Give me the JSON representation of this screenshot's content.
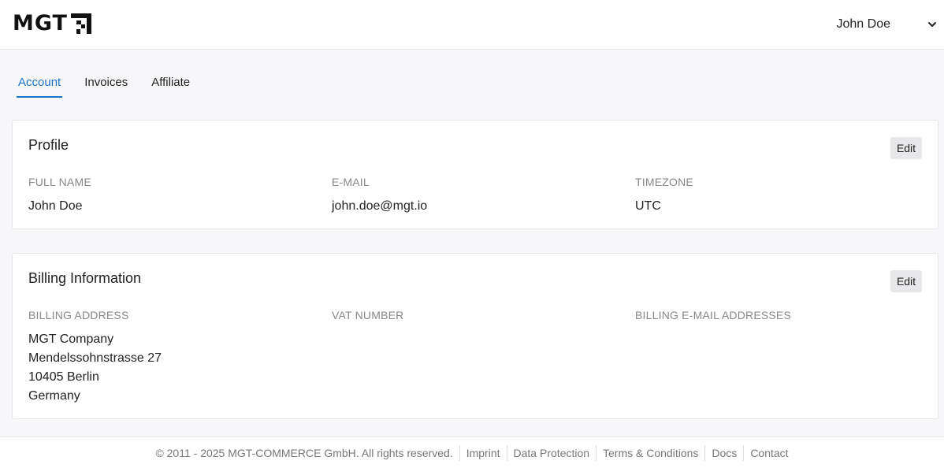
{
  "header": {
    "logo_text": "MGT",
    "user_name": "John Doe"
  },
  "tabs": [
    {
      "label": "Account",
      "active": true
    },
    {
      "label": "Invoices",
      "active": false
    },
    {
      "label": "Affiliate",
      "active": false
    }
  ],
  "profile": {
    "title": "Profile",
    "edit_label": "Edit",
    "fields": {
      "full_name": {
        "label": "FULL NAME",
        "value": "John Doe"
      },
      "email": {
        "label": "E-MAIL",
        "value": "john.doe@mgt.io"
      },
      "timezone": {
        "label": "TIMEZONE",
        "value": "UTC"
      }
    }
  },
  "billing": {
    "title": "Billing Information",
    "edit_label": "Edit",
    "address_label": "BILLING ADDRESS",
    "address_lines": [
      "MGT Company",
      "Mendelssohnstrasse 27",
      "10405 Berlin",
      "Germany"
    ],
    "vat_label": "VAT NUMBER",
    "vat_value": "",
    "emails_label": "BILLING E-MAIL ADDRESSES",
    "emails_value": ""
  },
  "footer": {
    "copyright": "© 2011 - 2025 MGT-COMMERCE GmbH. All rights reserved.",
    "links": [
      "Imprint",
      "Data Protection",
      "Terms & Conditions",
      "Docs",
      "Contact"
    ]
  },
  "colors": {
    "accent": "#1a73c9",
    "label": "#888888",
    "background": "#f7f7f9"
  }
}
